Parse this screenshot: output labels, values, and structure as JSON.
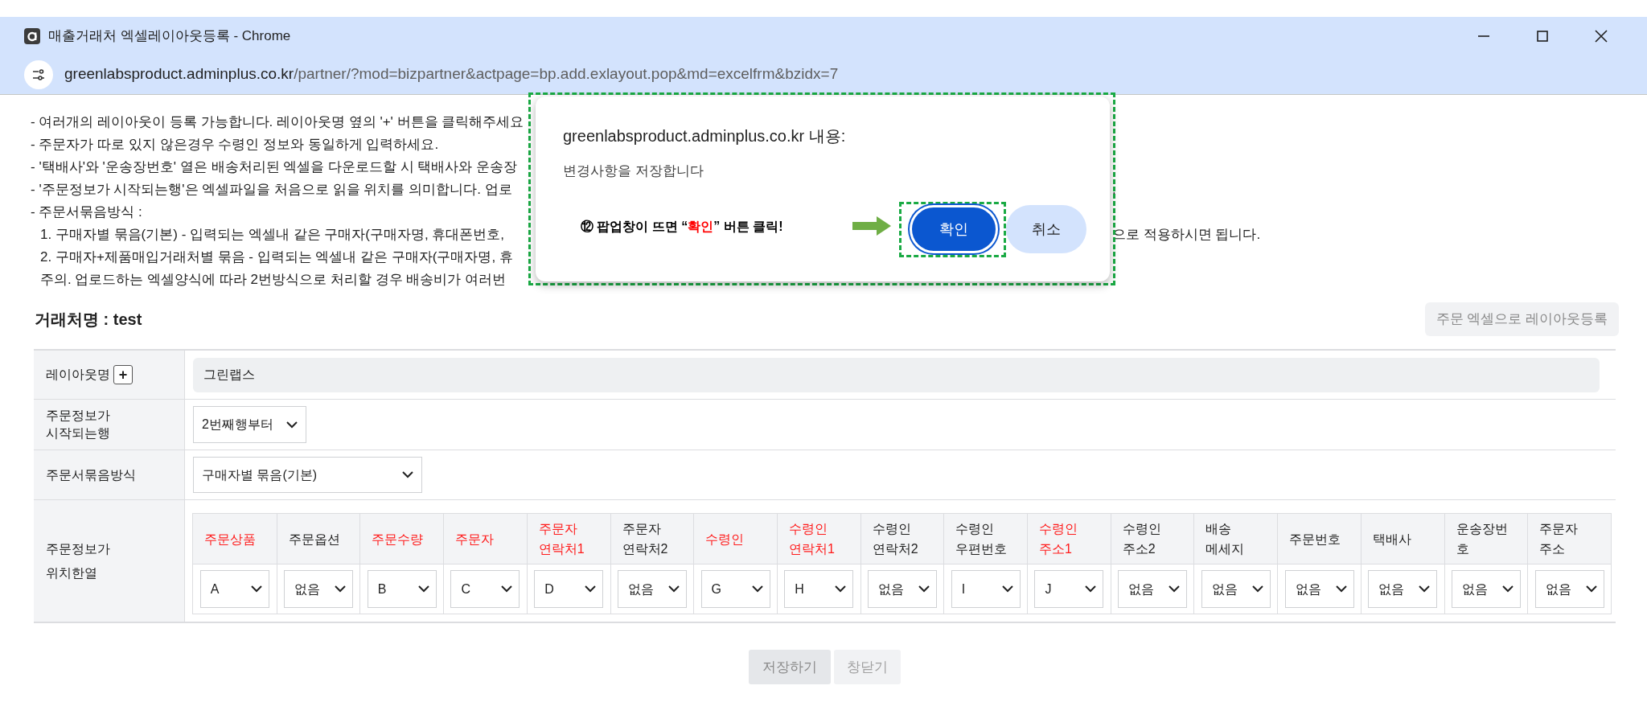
{
  "window": {
    "title": "매출거래처 엑셀레이아웃등록 - Chrome",
    "url_host": "greenlabsproduct.adminplus.co.kr",
    "url_path": "/partner/?mod=bizpartner&actpage=bp.add.exlayout.pop&md=excelfrm&bzidx=7"
  },
  "instructions": [
    {
      "left": "- 여러개의 레이아웃이 등록 가능합니다. 레이아웃명 옆의 '+' 버튼을 클릭해주세요"
    },
    {
      "left": "- 주문자가 따로 있지 않은경우 수령인 정보와 동일하게 입력하세요."
    },
    {
      "left": "- '택배사'와 '운송장번호' 열은 배송처리된 엑셀을 다운로드할 시 택배사와 운송장"
    },
    {
      "left": "- '주문정보가 시작되는행'은 엑셀파일을 처음으로 읽을 위치를 의미합니다. 업로",
      "right": "."
    },
    {
      "left": "- 주문서묶음방식 :",
      "children": [
        {
          "left": "1. 구매자별 묶음(기본) - 입력되는 엑셀내 같은 구매자(구매자명, 휴대폰번호,",
          "right": "으로 적용하시면 됩니다."
        },
        {
          "left": "2. 구매자+제품매입거래처별 묶음 - 입력되는 엑셀내 같은 구매자(구매자명, 휴"
        },
        {
          "left": "주의. 업로드하는 엑셀양식에 따라 2번방식으로 처리할 경우 배송비가 여러번"
        }
      ]
    }
  ],
  "partner_title": "거래처명 : test",
  "register_button": "주문 엑셀으로 레이아웃등록",
  "form": {
    "layout_name": {
      "label": "레이아웃명",
      "add_button": "+",
      "value": "그린랩스"
    },
    "start_row": {
      "label": "주문정보가\n시작되는행",
      "value": "2번째행부터"
    },
    "grouping": {
      "label": "주문서묶음방식",
      "value": "구매자별 묶음(기본)"
    },
    "columns_label": "주문정보가\n위치한열",
    "columns": [
      {
        "label": "주문상품",
        "required": true,
        "value": "A"
      },
      {
        "label": "주문옵션",
        "required": false,
        "value": "없음"
      },
      {
        "label": "주문수량",
        "required": true,
        "value": "B"
      },
      {
        "label": "주문자",
        "required": true,
        "value": "C"
      },
      {
        "label": "주문자\n연락처1",
        "required": true,
        "value": "D"
      },
      {
        "label": "주문자\n연락처2",
        "required": false,
        "value": "없음"
      },
      {
        "label": "수령인",
        "required": true,
        "value": "G"
      },
      {
        "label": "수령인\n연락처1",
        "required": true,
        "value": "H"
      },
      {
        "label": "수령인\n연락처2",
        "required": false,
        "value": "없음"
      },
      {
        "label": "수령인\n우편번호",
        "required": false,
        "value": "I"
      },
      {
        "label": "수령인\n주소1",
        "required": true,
        "value": "J"
      },
      {
        "label": "수령인\n주소2",
        "required": false,
        "value": "없음"
      },
      {
        "label": "배송\n메세지",
        "required": false,
        "value": "없음"
      },
      {
        "label": "주문번호",
        "required": false,
        "value": "없음"
      },
      {
        "label": "택배사",
        "required": false,
        "value": "없음"
      },
      {
        "label": "운송장번\n호",
        "required": false,
        "value": "없음"
      },
      {
        "label": "주문자\n주소",
        "required": false,
        "value": "없음"
      }
    ]
  },
  "bottom_buttons": [
    "저장하기",
    "창닫기"
  ],
  "dialog": {
    "title": "greenlabsproduct.adminplus.co.kr 내용:",
    "message": "변경사항을 저장합니다",
    "annotation": [
      {
        "text": "⑫ 팝업창이 뜨면 “",
        "highlight": false
      },
      {
        "text": "확인",
        "highlight": true
      },
      {
        "text": "” 버튼 클릭!",
        "highlight": false
      }
    ],
    "ok_button": "확인",
    "cancel_button": "취소"
  }
}
